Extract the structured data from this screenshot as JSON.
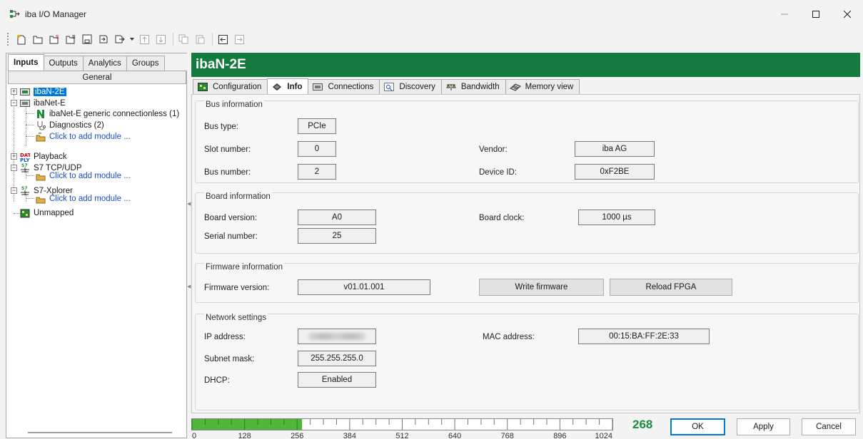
{
  "window": {
    "title": "iba I/O Manager"
  },
  "left": {
    "tabs": [
      "Inputs",
      "Outputs",
      "Analytics",
      "Groups"
    ],
    "general_label": "General",
    "tree": {
      "iban2e": "ibaN-2E",
      "ibanet": "ibaNet-E",
      "generic": "ibaNet-E generic connectionless (1)",
      "diagnostics": "Diagnostics (2)",
      "add1": "Click to add module ...",
      "playback": "Playback",
      "s7tcp": "S7 TCP/UDP",
      "add2": "Click to add module ...",
      "s7x": "S7-Xplorer",
      "add3": "Click to add module ...",
      "unmapped": "Unmapped"
    }
  },
  "header": {
    "title": "ibaN-2E"
  },
  "tabs": [
    "Configuration",
    "Info",
    "Connections",
    "Discovery",
    "Bandwidth",
    "Memory view"
  ],
  "bus": {
    "title": "Bus information",
    "bus_type_label": "Bus type:",
    "bus_type": "PCIe",
    "slot_label": "Slot number:",
    "slot": "0",
    "busnum_label": "Bus number:",
    "busnum": "2",
    "vendor_label": "Vendor:",
    "vendor": "iba AG",
    "device_label": "Device ID:",
    "device": "0xF2BE"
  },
  "board": {
    "title": "Board information",
    "version_label": "Board version:",
    "version": "A0",
    "serial_label": "Serial number:",
    "serial": "25",
    "clock_label": "Board clock:",
    "clock": "1000 µs"
  },
  "firmware": {
    "title": "Firmware information",
    "version_label": "Firmware version:",
    "version": "v01.01.001",
    "write_label": "Write firmware",
    "reload_label": "Reload FPGA"
  },
  "network": {
    "title": "Network settings",
    "ip_label": "IP address:",
    "subnet_label": "Subnet mask:",
    "subnet": "255.255.255.0",
    "dhcp_label": "DHCP:",
    "dhcp": "Enabled",
    "mac_label": "MAC address:",
    "mac": "00:15:BA:FF:2E:33"
  },
  "bottom": {
    "scale_labels": [
      "0",
      "128",
      "256",
      "384",
      "512",
      "640",
      "768",
      "896",
      "1024"
    ],
    "usage_value": 268,
    "usage_max": 1024,
    "count": "268",
    "ok": "OK",
    "apply": "Apply",
    "cancel": "Cancel"
  },
  "colors": {
    "header": "#147a3f",
    "accent": "#0078d7",
    "usage": "#1e8c3a",
    "link": "#1a4fc4"
  }
}
